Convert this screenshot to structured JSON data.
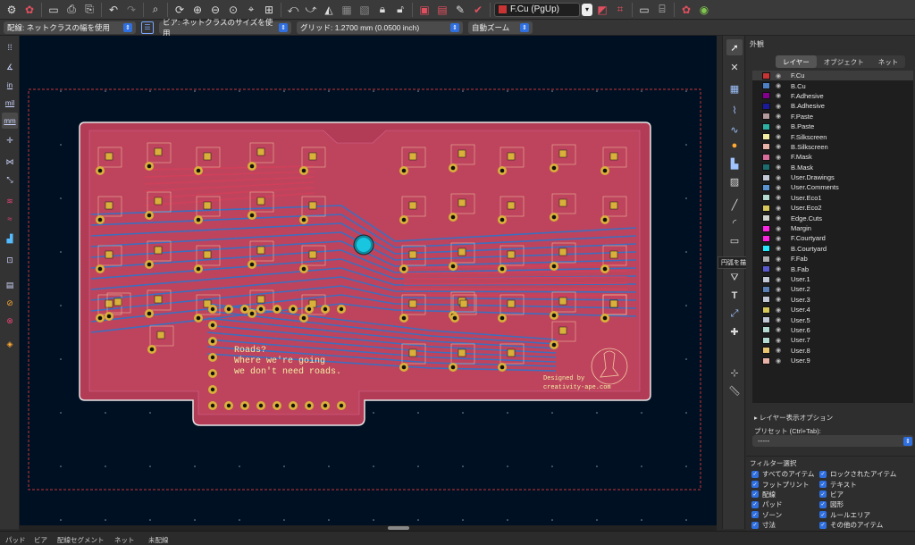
{
  "toolbar": {
    "icons": [
      "board-setup-icon",
      "schematic-icon",
      "page-settings-icon",
      "print-icon",
      "plot-icon",
      "undo-icon",
      "redo-icon",
      "find-icon",
      "refresh-icon",
      "zoom-in-icon",
      "zoom-out-icon",
      "zoom-fit-icon",
      "zoom-object-icon",
      "zoom-area-icon",
      "rotate-ccw-icon",
      "flip-icon",
      "group-icon",
      "lock-icon",
      "unlock-icon",
      "net-inspector-icon",
      "footprint-editor-icon",
      "drc-icon"
    ],
    "layer_selector": {
      "value": "F.Cu (PgUp)",
      "color": "#c83434"
    }
  },
  "toolbar2": {
    "track_width": "配線: ネットクラスの幅を使用",
    "via_size": "ビア: ネットクラスのサイズを使用",
    "grid": "グリッド: 1.2700 mm (0.0500 inch)",
    "zoom": "自動ズーム"
  },
  "left_toolbar": {
    "units": [
      "in",
      "mil",
      "mm"
    ]
  },
  "pcb": {
    "silk_text": [
      "Roads?",
      "Where we're going",
      "we don't need roads."
    ],
    "credit": [
      "Designed by",
      "creativity-ape.com"
    ]
  },
  "appearance": {
    "title": "外観",
    "tabs": [
      "レイヤー",
      "オブジェクト",
      "ネット"
    ],
    "active_tab": 0,
    "layers": [
      {
        "name": "F.Cu",
        "color": "#c83434"
      },
      {
        "name": "B.Cu",
        "color": "#4d7fc4"
      },
      {
        "name": "F.Adhesive",
        "color": "#84008c"
      },
      {
        "name": "B.Adhesive",
        "color": "#1a1a9c"
      },
      {
        "name": "F.Paste",
        "color": "#b49a9a"
      },
      {
        "name": "B.Paste",
        "color": "#2db0a4"
      },
      {
        "name": "F.Silkscreen",
        "color": "#f2eda1"
      },
      {
        "name": "B.Silkscreen",
        "color": "#e8b2a7"
      },
      {
        "name": "F.Mask",
        "color": "#d86c9a"
      },
      {
        "name": "B.Mask",
        "color": "#1c6d70"
      },
      {
        "name": "User.Drawings",
        "color": "#c2c8d6"
      },
      {
        "name": "User.Comments",
        "color": "#5993d4"
      },
      {
        "name": "User.Eco1",
        "color": "#b4dbd2"
      },
      {
        "name": "User.Eco2",
        "color": "#d8c85a"
      },
      {
        "name": "Edge.Cuts",
        "color": "#d0d2cd"
      },
      {
        "name": "Margin",
        "color": "#ff26e2"
      },
      {
        "name": "F.Courtyard",
        "color": "#ff26e2"
      },
      {
        "name": "B.Courtyard",
        "color": "#26e9ff"
      },
      {
        "name": "F.Fab",
        "color": "#afafaf"
      },
      {
        "name": "B.Fab",
        "color": "#5a5ad0"
      },
      {
        "name": "User.1",
        "color": "#c2c8d6"
      },
      {
        "name": "User.2",
        "color": "#597fb4"
      },
      {
        "name": "User.3",
        "color": "#c2c8d6"
      },
      {
        "name": "User.4",
        "color": "#d8c85a"
      },
      {
        "name": "User.5",
        "color": "#c2c8d6"
      },
      {
        "name": "User.6",
        "color": "#b4dbd2"
      },
      {
        "name": "User.7",
        "color": "#b4dbd2"
      },
      {
        "name": "User.8",
        "color": "#e8c66e"
      },
      {
        "name": "User.9",
        "color": "#e8b2a7"
      }
    ],
    "layer_options": "レイヤー表示オプション",
    "preset_label": "プリセット (Ctrl+Tab):",
    "preset_value": "-----"
  },
  "tooltip": "円弧を描画 (Cmd+Shift+A)",
  "filter": {
    "title": "フィルター選択",
    "left": [
      "すべてのアイテム",
      "フットプリント",
      "配線",
      "パッド",
      "ゾーン",
      "寸法"
    ],
    "right": [
      "ロックされたアイテム",
      "テキスト",
      "ビア",
      "図形",
      "ルールエリア",
      "その他のアイテム"
    ]
  },
  "status": [
    "パッド",
    "ビア",
    "配線セグメント",
    "ネット",
    "未配線"
  ]
}
